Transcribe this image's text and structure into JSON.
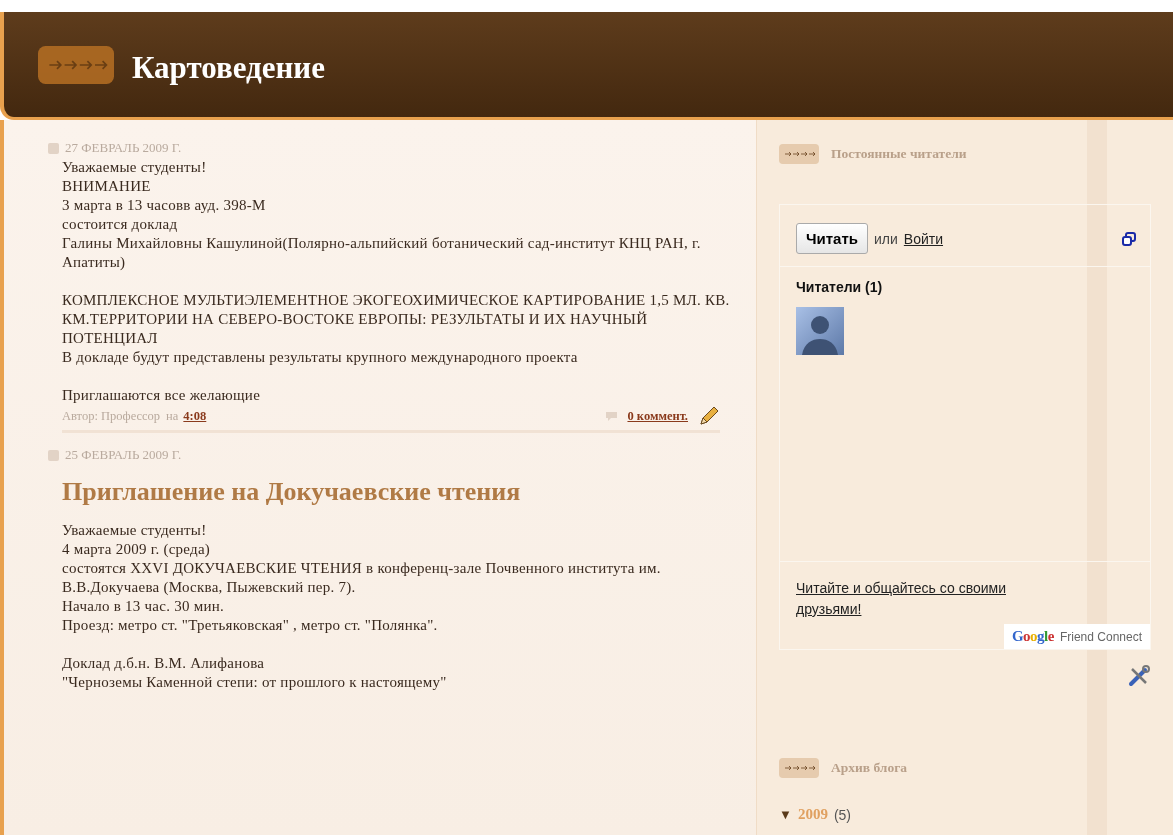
{
  "header": {
    "title": "Картоведение"
  },
  "posts": [
    {
      "date": "27 ФЕВРАЛЬ 2009 Г.",
      "paragraphs": [
        "Уважаемые студенты!\nВНИМАНИЕ\n3 марта в 13 часовв ауд. 398-М\nсостоится доклад\nГалины Михайловны Кашулиной(Полярно-альпийский ботанический сад-институт КНЦ РАН, г. Апатиты)",
        "КОМПЛЕКСНОЕ МУЛЬТИЭЛЕМЕНТНОЕ ЭКОГЕОХИМИЧЕСКОЕ КАРТИРОВАНИЕ 1,5 МЛ. КВ. КМ.ТЕРРИТОРИИ НА СЕВЕРО-ВОСТОКЕ ЕВРОПЫ: РЕЗУЛЬТАТЫ И ИХ НАУЧНЫЙ ПОТЕНЦИАЛ\nВ докладе будут представлены результаты крупного международного проекта",
        "Приглашаются все желающие"
      ],
      "footer": {
        "author": "Автор: Профессор",
        "at": "на",
        "time": "4:08",
        "comments": "0 коммент."
      }
    },
    {
      "date": "25 ФЕВРАЛЬ 2009 Г.",
      "title": "Приглашение на Докучаевские чтения",
      "paragraphs": [
        "Уважаемые студенты!\n4 марта 2009 г. (среда)\nсостоятся XXVI  ДОКУЧАЕВСКИЕ ЧТЕНИЯ в конференц-зале Почвенного института им. В.В.Докучаева (Москва, Пыжевский пер. 7).\nНачало в 13 час. 30 мин.\nПроезд: метро ст. \"Третьяковская\" , метро ст. \"Полянка\".",
        "Доклад д.б.н. В.М. Алифанова\n\"Черноземы Каменной степи: от прошлого к настоящему\""
      ]
    }
  ],
  "sidebar": {
    "followers": {
      "heading": "Постоянные читатели",
      "follow_button": "Читать",
      "or": "или",
      "login": "Войти",
      "readers_label": "Читатели (1)",
      "invite": "Читайте и общайтесь со своими друзьями!",
      "brand_google": "Google",
      "brand_rest": "Friend Connect"
    },
    "archive": {
      "heading": "Архив блога",
      "years": [
        {
          "toggle": "▼",
          "year": "2009",
          "count": "(5)",
          "expanded": true
        }
      ]
    }
  }
}
